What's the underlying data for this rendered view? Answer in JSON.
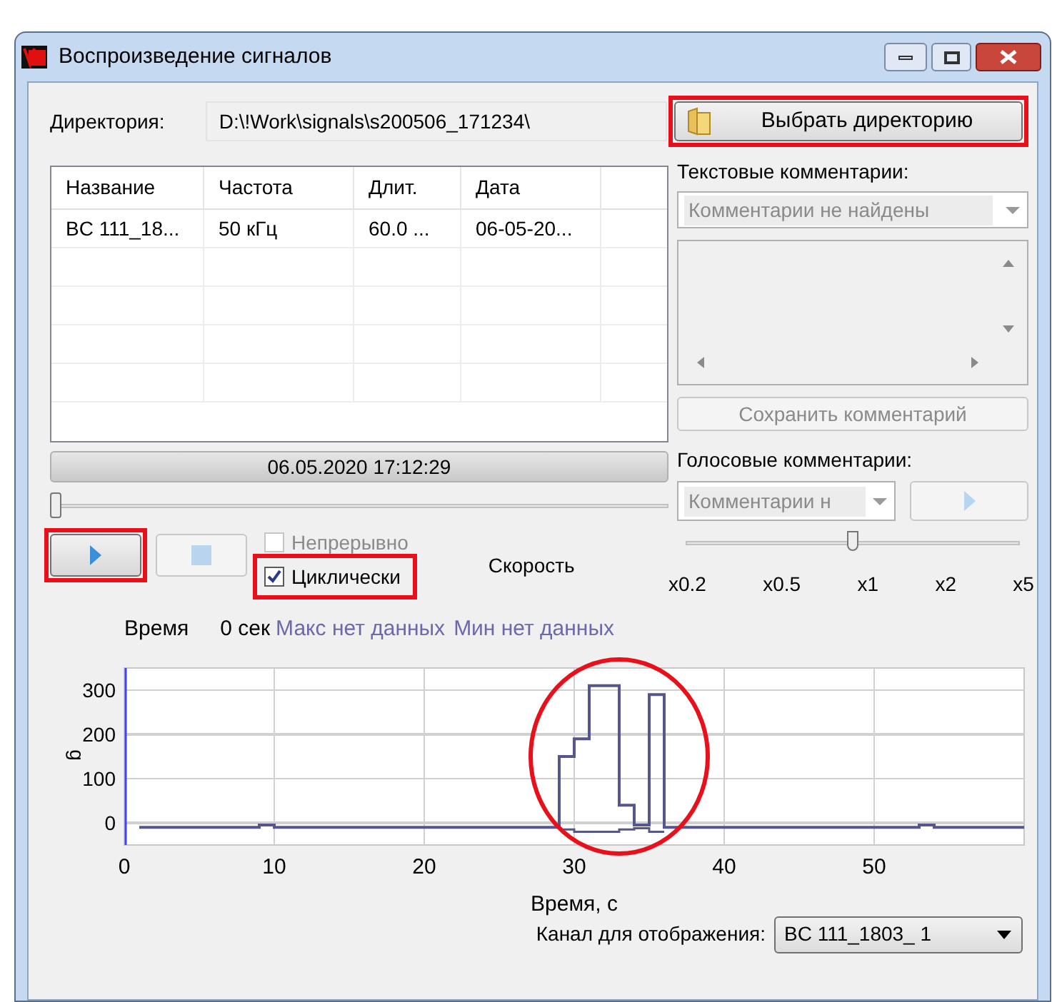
{
  "window": {
    "title": "Воспроизведение сигналов"
  },
  "directory": {
    "label": "Директория:",
    "value": "D:\\!Work\\signals\\s200506_171234\\",
    "button": "Выбрать директорию",
    "highlighted": true
  },
  "table": {
    "columns": [
      "Название",
      "Частота",
      "Длит.",
      "Дата"
    ],
    "rows": [
      {
        "cells": [
          "BC 111_18...",
          "50 кГц",
          "60.0 ...",
          "06-05-20..."
        ]
      }
    ]
  },
  "text_comments": {
    "label": "Текстовые комментарии:",
    "combo": "Комментарии не найдены",
    "save_button": "Сохранить комментарий",
    "disabled": true
  },
  "timestamp": "06.05.2020 17:12:29",
  "position_slider": {
    "level": 0
  },
  "voice_comments": {
    "label": "Голосовые комментарии:",
    "combo": "Комментарии н",
    "disabled": true
  },
  "play_button": {
    "highlighted": true
  },
  "stop_button": {
    "disabled": true
  },
  "checkboxes": [
    {
      "label": "Непрерывно",
      "checked": false,
      "disabled": true,
      "highlighted": false
    },
    {
      "label": "Циклически",
      "checked": true,
      "disabled": false,
      "highlighted": true
    }
  ],
  "speed": {
    "label": "Скорость",
    "level": 0.5,
    "ticks": [
      "x0.2",
      "x0.5",
      "x1",
      "x2",
      "x5"
    ]
  },
  "time_row": {
    "label": "Время",
    "value": "0 сек",
    "max": "Макс нет данных",
    "min": "Мин нет данных"
  },
  "chart_highlighted": true,
  "chart_data": {
    "type": "line",
    "grid": true,
    "xlabel": "Время, с",
    "ylabel": "g",
    "xlim": [
      0,
      60
    ],
    "ylim": [
      -50,
      350
    ],
    "xticks": [
      0,
      10,
      20,
      30,
      40,
      50
    ],
    "yticks": [
      0,
      100,
      200,
      300
    ],
    "series": [
      {
        "color": "#56568e",
        "x": [
          1,
          9,
          9,
          10,
          10,
          29,
          29,
          30,
          30,
          31,
          31,
          33,
          33,
          34,
          34,
          35,
          35,
          36,
          36,
          53,
          53,
          54,
          54,
          60
        ],
        "values": [
          -10,
          -10,
          -5,
          -5,
          -10,
          -10,
          150,
          150,
          190,
          190,
          310,
          310,
          40,
          40,
          -5,
          -5,
          290,
          290,
          -10,
          -10,
          -5,
          -5,
          -10,
          -10
        ]
      },
      {
        "color": "#56568e",
        "x": [
          29,
          30,
          30,
          33,
          33,
          34,
          34,
          35,
          35,
          36
        ],
        "values": [
          -15,
          -15,
          -20,
          -20,
          -15,
          -15,
          -12,
          -12,
          -20,
          -20
        ]
      }
    ]
  },
  "channel": {
    "label": "Канал для отображения:",
    "value": "BC 111_1803_ 1"
  }
}
